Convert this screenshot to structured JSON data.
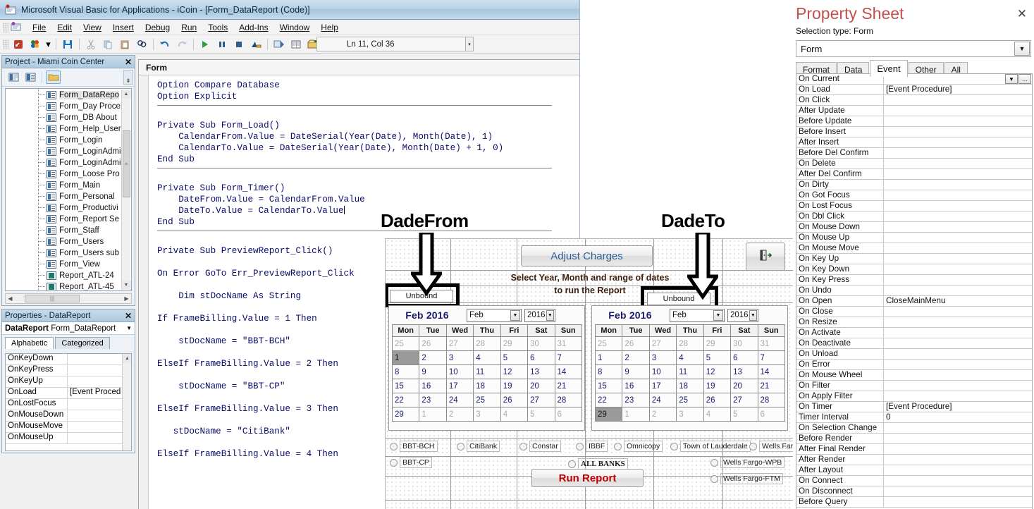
{
  "vba": {
    "title": "Microsoft Visual Basic for Applications - iCoin - [Form_DataReport (Code)]",
    "app_icon": "vba-app-icon",
    "menu": [
      "File",
      "Edit",
      "View",
      "Insert",
      "Debug",
      "Run",
      "Tools",
      "Add-Ins",
      "Window",
      "Help"
    ],
    "toolbar_icons": [
      "view-microsoft-access-icon",
      "insert-module-icon",
      "insert-dropdown-arrow-icon",
      "save-icon",
      "cut-icon",
      "copy-icon",
      "paste-icon",
      "find-icon",
      "undo-icon",
      "redo-icon",
      "run-icon",
      "break-icon",
      "reset-icon",
      "design-mode-icon",
      "project-explorer-icon",
      "properties-window-icon",
      "object-browser-icon",
      "toolbox-icon",
      "help-icon"
    ],
    "position_indicator": "Ln 11, Col 36",
    "code_tab": "Form",
    "code_lines": [
      "Option Compare Database",
      "Option Explicit",
      "",
      "Private Sub Form_Load()",
      "    CalendarFrom.Value = DateSerial(Year(Date), Month(Date), 1)",
      "    CalendarTo.Value = DateSerial(Year(Date), Month(Date) + 1, 0)",
      "End Sub",
      "",
      "Private Sub Form_Timer()",
      "    DateFrom.Value = CalendarFrom.Value",
      "    DateTo.Value = CalendarTo.Value",
      "End Sub",
      "",
      "Private Sub PreviewReport_Click()",
      "",
      "On Error GoTo Err_PreviewReport_Click",
      "",
      "    Dim stDocName As String",
      "",
      "If FrameBilling.Value = 1 Then",
      "",
      "    stDocName = \"BBT-BCH\"",
      "",
      "ElseIf FrameBilling.Value = 2 Then",
      "",
      "    stDocName = \"BBT-CP\"",
      "",
      "ElseIf FrameBilling.Value = 3 Then",
      "",
      "   stDocName = \"CitiBank\"",
      "",
      "ElseIf FrameBilling.Value = 4 Then"
    ]
  },
  "project_panel": {
    "title": "Project - Miami Coin Center",
    "close_label": "✕",
    "toolbar_icons": [
      "view-code-icon",
      "view-object-icon",
      "toggle-folders-icon"
    ],
    "tree_items": [
      {
        "label": "Form_DataRepo",
        "kind": "form",
        "selected": true
      },
      {
        "label": "Form_Day Proce",
        "kind": "form",
        "selected": false
      },
      {
        "label": "Form_DB About",
        "kind": "form",
        "selected": false
      },
      {
        "label": "Form_Help_User",
        "kind": "form",
        "selected": false
      },
      {
        "label": "Form_Login",
        "kind": "form",
        "selected": false
      },
      {
        "label": "Form_LoginAdmi",
        "kind": "form",
        "selected": false
      },
      {
        "label": "Form_LoginAdmi",
        "kind": "form",
        "selected": false
      },
      {
        "label": "Form_Loose Pro",
        "kind": "form",
        "selected": false
      },
      {
        "label": "Form_Main",
        "kind": "form",
        "selected": false
      },
      {
        "label": "Form_Personal",
        "kind": "form",
        "selected": false
      },
      {
        "label": "Form_Productivi",
        "kind": "form",
        "selected": false
      },
      {
        "label": "Form_Report Se",
        "kind": "form",
        "selected": false
      },
      {
        "label": "Form_Staff",
        "kind": "form",
        "selected": false
      },
      {
        "label": "Form_Users",
        "kind": "form",
        "selected": false
      },
      {
        "label": "Form_Users sub",
        "kind": "form",
        "selected": false
      },
      {
        "label": "Form_View",
        "kind": "form",
        "selected": false
      },
      {
        "label": "Report_ATL-24",
        "kind": "report",
        "selected": false
      },
      {
        "label": "Report_ATL-45",
        "kind": "report",
        "selected": false
      }
    ]
  },
  "properties_panel": {
    "title": "Properties - DataReport",
    "close_label": "✕",
    "object_name": "DataReport",
    "object_type": "Form_DataReport",
    "tabs": [
      "Alphabetic",
      "Categorized"
    ],
    "active_tab": "Alphabetic",
    "rows": [
      {
        "name": "OnKeyDown",
        "value": ""
      },
      {
        "name": "OnKeyPress",
        "value": ""
      },
      {
        "name": "OnKeyUp",
        "value": ""
      },
      {
        "name": "OnLoad",
        "value": "[Event Proced"
      },
      {
        "name": "OnLostFocus",
        "value": ""
      },
      {
        "name": "OnMouseDown",
        "value": ""
      },
      {
        "name": "OnMouseMove",
        "value": ""
      },
      {
        "name": "OnMouseUp",
        "value": ""
      }
    ]
  },
  "access_form": {
    "adjust_charges_label": "Adjust Charges",
    "exit_button_icon": "exit-door-icon",
    "instruction_line1": "Select Year, Month and range of dates",
    "instruction_line2": "to run the Report",
    "unbound_from_value": "Unbound",
    "unbound_to_value": "Unbound",
    "annotation_from": "DadeFrom",
    "annotation_to": "DadeTo",
    "calendar_from": {
      "title": "Feb 2016",
      "month": "Feb",
      "year": "2016",
      "day_headers": [
        "Mon",
        "Tue",
        "Wed",
        "Thu",
        "Fri",
        "Sat",
        "Sun"
      ],
      "weeks": [
        [
          {
            "d": "25",
            "o": true
          },
          {
            "d": "26",
            "o": true
          },
          {
            "d": "27",
            "o": true
          },
          {
            "d": "28",
            "o": true
          },
          {
            "d": "29",
            "o": true
          },
          {
            "d": "30",
            "o": true
          },
          {
            "d": "31",
            "o": true
          }
        ],
        [
          {
            "d": "1",
            "s": true
          },
          {
            "d": "2"
          },
          {
            "d": "3"
          },
          {
            "d": "4"
          },
          {
            "d": "5"
          },
          {
            "d": "6"
          },
          {
            "d": "7"
          }
        ],
        [
          {
            "d": "8"
          },
          {
            "d": "9"
          },
          {
            "d": "10"
          },
          {
            "d": "11"
          },
          {
            "d": "12"
          },
          {
            "d": "13"
          },
          {
            "d": "14"
          }
        ],
        [
          {
            "d": "15"
          },
          {
            "d": "16"
          },
          {
            "d": "17"
          },
          {
            "d": "18"
          },
          {
            "d": "19"
          },
          {
            "d": "20"
          },
          {
            "d": "21"
          }
        ],
        [
          {
            "d": "22"
          },
          {
            "d": "23"
          },
          {
            "d": "24"
          },
          {
            "d": "25"
          },
          {
            "d": "26"
          },
          {
            "d": "27"
          },
          {
            "d": "28"
          }
        ],
        [
          {
            "d": "29"
          },
          {
            "d": "1",
            "o": true
          },
          {
            "d": "2",
            "o": true
          },
          {
            "d": "3",
            "o": true
          },
          {
            "d": "4",
            "o": true
          },
          {
            "d": "5",
            "o": true
          },
          {
            "d": "6",
            "o": true
          }
        ]
      ]
    },
    "calendar_to": {
      "title": "Feb 2016",
      "month": "Feb",
      "year": "2016",
      "day_headers": [
        "Mon",
        "Tue",
        "Wed",
        "Thu",
        "Fri",
        "Sat",
        "Sun"
      ],
      "weeks": [
        [
          {
            "d": "25",
            "o": true
          },
          {
            "d": "26",
            "o": true
          },
          {
            "d": "27",
            "o": true
          },
          {
            "d": "28",
            "o": true
          },
          {
            "d": "29",
            "o": true
          },
          {
            "d": "30",
            "o": true
          },
          {
            "d": "31",
            "o": true
          }
        ],
        [
          {
            "d": "1"
          },
          {
            "d": "2"
          },
          {
            "d": "3"
          },
          {
            "d": "4"
          },
          {
            "d": "5"
          },
          {
            "d": "6"
          },
          {
            "d": "7"
          }
        ],
        [
          {
            "d": "8"
          },
          {
            "d": "9"
          },
          {
            "d": "10"
          },
          {
            "d": "11"
          },
          {
            "d": "12"
          },
          {
            "d": "13"
          },
          {
            "d": "14"
          }
        ],
        [
          {
            "d": "15"
          },
          {
            "d": "16"
          },
          {
            "d": "17"
          },
          {
            "d": "18"
          },
          {
            "d": "19"
          },
          {
            "d": "20"
          },
          {
            "d": "21"
          }
        ],
        [
          {
            "d": "22"
          },
          {
            "d": "23"
          },
          {
            "d": "24"
          },
          {
            "d": "25"
          },
          {
            "d": "26"
          },
          {
            "d": "27"
          },
          {
            "d": "28"
          }
        ],
        [
          {
            "d": "29",
            "s": true
          },
          {
            "d": "1",
            "o": true
          },
          {
            "d": "2",
            "o": true
          },
          {
            "d": "3",
            "o": true
          },
          {
            "d": "4",
            "o": true
          },
          {
            "d": "5",
            "o": true
          },
          {
            "d": "6",
            "o": true
          }
        ]
      ]
    },
    "banks_row1": [
      "BBT-BCH",
      "CitiBank",
      "Constar",
      "IBBF",
      "Omnicopy",
      "Town of Lauderdale",
      "Wells Fargo-MIA"
    ],
    "bank_bbt_cp": "BBT-CP",
    "bank_all": "ALL BANKS",
    "bank_wfwpb": "Wells Fargo-WPB",
    "bank_wfftm": "Wells Fargo-FTM",
    "run_report_label": "Run Report"
  },
  "property_sheet": {
    "title": "Property Sheet",
    "close_label": "✕",
    "selection_type": "Selection type:  Form",
    "object_value": "Form",
    "tabs": [
      "Format",
      "Data",
      "Event",
      "Other",
      "All"
    ],
    "active_tab": "Event",
    "rows": [
      {
        "name": "On Current",
        "value": ""
      },
      {
        "name": "On Load",
        "value": "[Event Procedure]"
      },
      {
        "name": "On Click",
        "value": ""
      },
      {
        "name": "After Update",
        "value": ""
      },
      {
        "name": "Before Update",
        "value": ""
      },
      {
        "name": "Before Insert",
        "value": ""
      },
      {
        "name": "After Insert",
        "value": ""
      },
      {
        "name": "Before Del Confirm",
        "value": ""
      },
      {
        "name": "On Delete",
        "value": ""
      },
      {
        "name": "After Del Confirm",
        "value": ""
      },
      {
        "name": "On Dirty",
        "value": ""
      },
      {
        "name": "On Got Focus",
        "value": ""
      },
      {
        "name": "On Lost Focus",
        "value": ""
      },
      {
        "name": "On Dbl Click",
        "value": ""
      },
      {
        "name": "On Mouse Down",
        "value": ""
      },
      {
        "name": "On Mouse Up",
        "value": ""
      },
      {
        "name": "On Mouse Move",
        "value": ""
      },
      {
        "name": "On Key Up",
        "value": ""
      },
      {
        "name": "On Key Down",
        "value": ""
      },
      {
        "name": "On Key Press",
        "value": ""
      },
      {
        "name": "On Undo",
        "value": ""
      },
      {
        "name": "On Open",
        "value": "CloseMainMenu"
      },
      {
        "name": "On Close",
        "value": ""
      },
      {
        "name": "On Resize",
        "value": ""
      },
      {
        "name": "On Activate",
        "value": ""
      },
      {
        "name": "On Deactivate",
        "value": ""
      },
      {
        "name": "On Unload",
        "value": ""
      },
      {
        "name": "On Error",
        "value": ""
      },
      {
        "name": "On Mouse Wheel",
        "value": ""
      },
      {
        "name": "On Filter",
        "value": ""
      },
      {
        "name": "On Apply Filter",
        "value": ""
      },
      {
        "name": "On Timer",
        "value": "[Event Procedure]"
      },
      {
        "name": "Timer Interval",
        "value": "0"
      },
      {
        "name": "On Selection Change",
        "value": ""
      },
      {
        "name": "Before Render",
        "value": ""
      },
      {
        "name": "After Final Render",
        "value": ""
      },
      {
        "name": "After Render",
        "value": ""
      },
      {
        "name": "After Layout",
        "value": ""
      },
      {
        "name": "On Connect",
        "value": ""
      },
      {
        "name": "On Disconnect",
        "value": ""
      },
      {
        "name": "Before Query",
        "value": ""
      }
    ]
  },
  "colors": {
    "titlebar": "#a7c6de",
    "accent_red": "#c0504d",
    "calendar_title": "#191970",
    "run_report_red": "#c00000",
    "adjust_charges_blue": "#2e5f94"
  }
}
